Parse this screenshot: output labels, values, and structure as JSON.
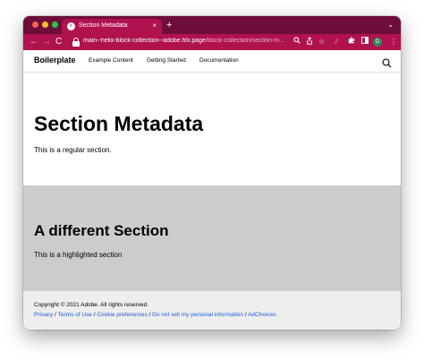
{
  "browser": {
    "tab_title": "Section Metadata",
    "tab_close": "×",
    "new_tab": "+",
    "tabs_menu": "⌄",
    "url_host": "main--helix-block-collection--adobe.hlx.page",
    "url_path": "/block-collection/section-m...",
    "profile_initial": "D",
    "colors": {
      "tabstrip": "#6d0e3a",
      "toolbar": "#b0124f"
    }
  },
  "site": {
    "brand": "Boilerplate",
    "nav": [
      "Example Content",
      "Getting Started",
      "Documentation"
    ]
  },
  "section1": {
    "title": "Section Metadata",
    "text": "This is a regular section."
  },
  "section2": {
    "title": "A different Section",
    "text": "This is a highlighted section",
    "background": "#cccccc"
  },
  "footer": {
    "copyright": "Copyright © 2021 Adobe. All rights reserved.",
    "links": [
      "Privacy",
      "Terms of Use",
      "Cookie preferences",
      "Do not sell my personal information",
      "AdChoices"
    ],
    "separator": " / "
  }
}
